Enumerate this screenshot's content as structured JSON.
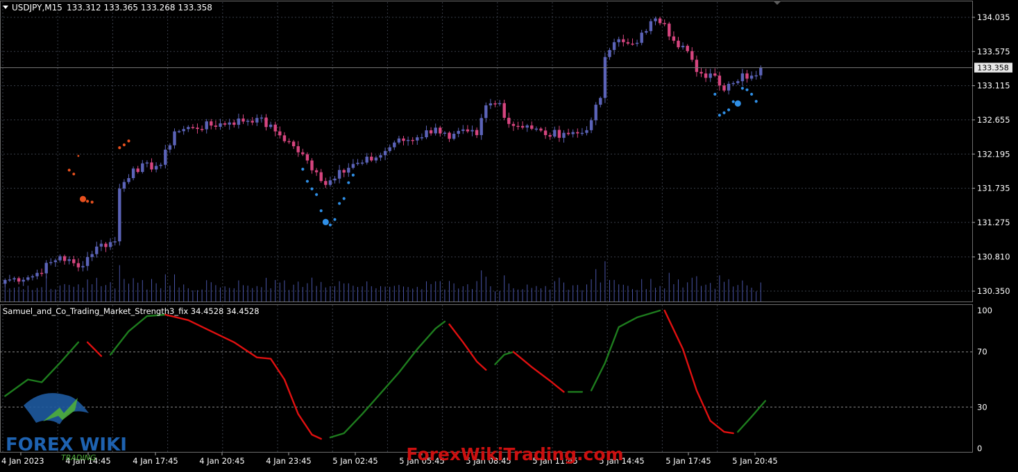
{
  "header": {
    "symbol": "USDJPY,M15",
    "ohlc": "133.312 133.365 133.268 133.358"
  },
  "indicator": {
    "label": "Samuel_and_Co_Trading_Market_Strength3_fix 34.4528 34.4528"
  },
  "price_axis": {
    "ticks": [
      "134.035",
      "133.575",
      "133.115",
      "132.655",
      "132.195",
      "131.735",
      "131.275",
      "130.810",
      "130.350"
    ],
    "current_price": "133.358"
  },
  "indicator_axis": {
    "ticks": [
      "100",
      "70",
      "30",
      "0"
    ]
  },
  "time_axis": {
    "ticks": [
      "4 Jan 2023",
      "4 Jan 14:45",
      "4 Jan 17:45",
      "4 Jan 20:45",
      "4 Jan 23:45",
      "5 Jan 02:45",
      "5 Jan 05:45",
      "5 Jan 08:45",
      "5 Jan 11:45",
      "5 Jan 14:45",
      "5 Jan 17:45",
      "5 Jan 20:45"
    ]
  },
  "watermark": {
    "site": "ForexWikiTrading.com",
    "logo_text": "FOREX WIKI",
    "logo_sub": "TRADING"
  },
  "colors": {
    "background": "#000000",
    "bull_candle": "#5b63b8",
    "bear_candle": "#d6457f",
    "volume": "#4a55a8",
    "grid": "#3a3f4a",
    "strength_up": "#1e7d1e",
    "strength_down": "#e01010",
    "dots_sell": "#e8501e",
    "dots_buy": "#2f8fe6",
    "watermark_red": "#cc1010"
  },
  "chart_data": [
    {
      "type": "candlestick",
      "title": "USDJPY,M15",
      "ylim": [
        130.22,
        134.24
      ],
      "y_ticks": [
        134.035,
        133.575,
        133.115,
        132.655,
        132.195,
        131.735,
        131.275,
        130.81,
        130.35
      ],
      "current_price": 133.358,
      "key_points": [
        {
          "bar": 0,
          "close": 130.5
        },
        {
          "bar": 6,
          "close": 130.55
        },
        {
          "bar": 12,
          "close": 130.82
        },
        {
          "bar": 16,
          "close": 130.67
        },
        {
          "bar": 20,
          "close": 130.95
        },
        {
          "bar": 24,
          "close": 131.02
        },
        {
          "bar": 25,
          "close": 131.73
        },
        {
          "bar": 28,
          "close": 132.0
        },
        {
          "bar": 34,
          "close": 132.05
        },
        {
          "bar": 37,
          "close": 132.5
        },
        {
          "bar": 41,
          "close": 132.55
        },
        {
          "bar": 49,
          "close": 132.62
        },
        {
          "bar": 55,
          "close": 132.68
        },
        {
          "bar": 59,
          "close": 132.5
        },
        {
          "bar": 63,
          "close": 132.3
        },
        {
          "bar": 68,
          "close": 131.95
        },
        {
          "bar": 70,
          "close": 131.78
        },
        {
          "bar": 73,
          "close": 131.98
        },
        {
          "bar": 78,
          "close": 132.08
        },
        {
          "bar": 82,
          "close": 132.18
        },
        {
          "bar": 85,
          "close": 132.35
        },
        {
          "bar": 90,
          "close": 132.42
        },
        {
          "bar": 94,
          "close": 132.55
        },
        {
          "bar": 97,
          "close": 132.4
        },
        {
          "bar": 101,
          "close": 132.5
        },
        {
          "bar": 103,
          "close": 132.45
        },
        {
          "bar": 105,
          "close": 132.85
        },
        {
          "bar": 108,
          "close": 132.88
        },
        {
          "bar": 110,
          "close": 132.6
        },
        {
          "bar": 114,
          "close": 132.58
        },
        {
          "bar": 118,
          "close": 132.45
        },
        {
          "bar": 122,
          "close": 132.48
        },
        {
          "bar": 126,
          "close": 132.48
        },
        {
          "bar": 128,
          "close": 132.65
        },
        {
          "bar": 130,
          "close": 132.95
        },
        {
          "bar": 131,
          "close": 133.5
        },
        {
          "bar": 133,
          "close": 133.7
        },
        {
          "bar": 137,
          "close": 133.68
        },
        {
          "bar": 140,
          "close": 133.85
        },
        {
          "bar": 142,
          "close": 134.02
        },
        {
          "bar": 144,
          "close": 133.95
        },
        {
          "bar": 146,
          "close": 133.72
        },
        {
          "bar": 149,
          "close": 133.58
        },
        {
          "bar": 151,
          "close": 133.3
        },
        {
          "bar": 153,
          "close": 133.22
        },
        {
          "bar": 155,
          "close": 133.25
        },
        {
          "bar": 157,
          "close": 133.05
        },
        {
          "bar": 159,
          "close": 133.15
        },
        {
          "bar": 161,
          "close": 133.28
        },
        {
          "bar": 163,
          "close": 133.25
        },
        {
          "bar": 165,
          "close": 133.358
        }
      ]
    },
    {
      "type": "line",
      "title": "Samuel_and_Co_Trading_Market_Strength3_fix",
      "values_shown": [
        34.4528,
        34.4528
      ],
      "ylim": [
        0,
        100
      ],
      "y_ticks": [
        100,
        70,
        30,
        0
      ],
      "series": [
        {
          "name": "",
          "color": "up",
          "x": [
            0,
            5,
            8,
            12,
            16
          ],
          "values": [
            38,
            50,
            48,
            62,
            77
          ]
        },
        {
          "name": "",
          "color": "down",
          "x": [
            18,
            21
          ],
          "values": [
            77,
            67
          ]
        },
        {
          "name": "",
          "color": "up",
          "x": [
            23,
            27,
            31,
            35
          ],
          "values": [
            68,
            85,
            96,
            97
          ]
        },
        {
          "name": "",
          "color": "down",
          "x": [
            35,
            40,
            45,
            50,
            55,
            58,
            61,
            64,
            67,
            69
          ],
          "values": [
            97,
            93,
            85,
            77,
            66,
            65,
            50,
            25,
            10,
            7
          ]
        },
        {
          "name": "",
          "color": "up",
          "x": [
            71,
            74,
            78,
            82,
            86,
            90,
            94,
            96
          ],
          "values": [
            8,
            11,
            25,
            40,
            55,
            72,
            87,
            92
          ]
        },
        {
          "name": "",
          "color": "down",
          "x": [
            97,
            100,
            103,
            105
          ],
          "values": [
            90,
            77,
            63,
            57
          ]
        },
        {
          "name": "",
          "color": "up",
          "x": [
            107,
            109,
            111
          ],
          "values": [
            61,
            68,
            70
          ]
        },
        {
          "name": "",
          "color": "down",
          "x": [
            111,
            115,
            119,
            122
          ],
          "values": [
            70,
            59,
            49,
            41
          ]
        },
        {
          "name": "",
          "color": "up",
          "x": [
            123,
            126
          ],
          "values": [
            41,
            41
          ]
        },
        {
          "name": "",
          "color": "up",
          "x": [
            128,
            131,
            134,
            138,
            143
          ],
          "values": [
            42,
            62,
            88,
            95,
            100
          ]
        },
        {
          "name": "",
          "color": "down",
          "x": [
            144,
            148,
            151,
            154,
            157,
            159
          ],
          "values": [
            100,
            72,
            42,
            20,
            12,
            11
          ]
        },
        {
          "name": "",
          "color": "up",
          "x": [
            160,
            163,
            166
          ],
          "values": [
            12,
            23,
            34.4528
          ]
        }
      ]
    }
  ]
}
